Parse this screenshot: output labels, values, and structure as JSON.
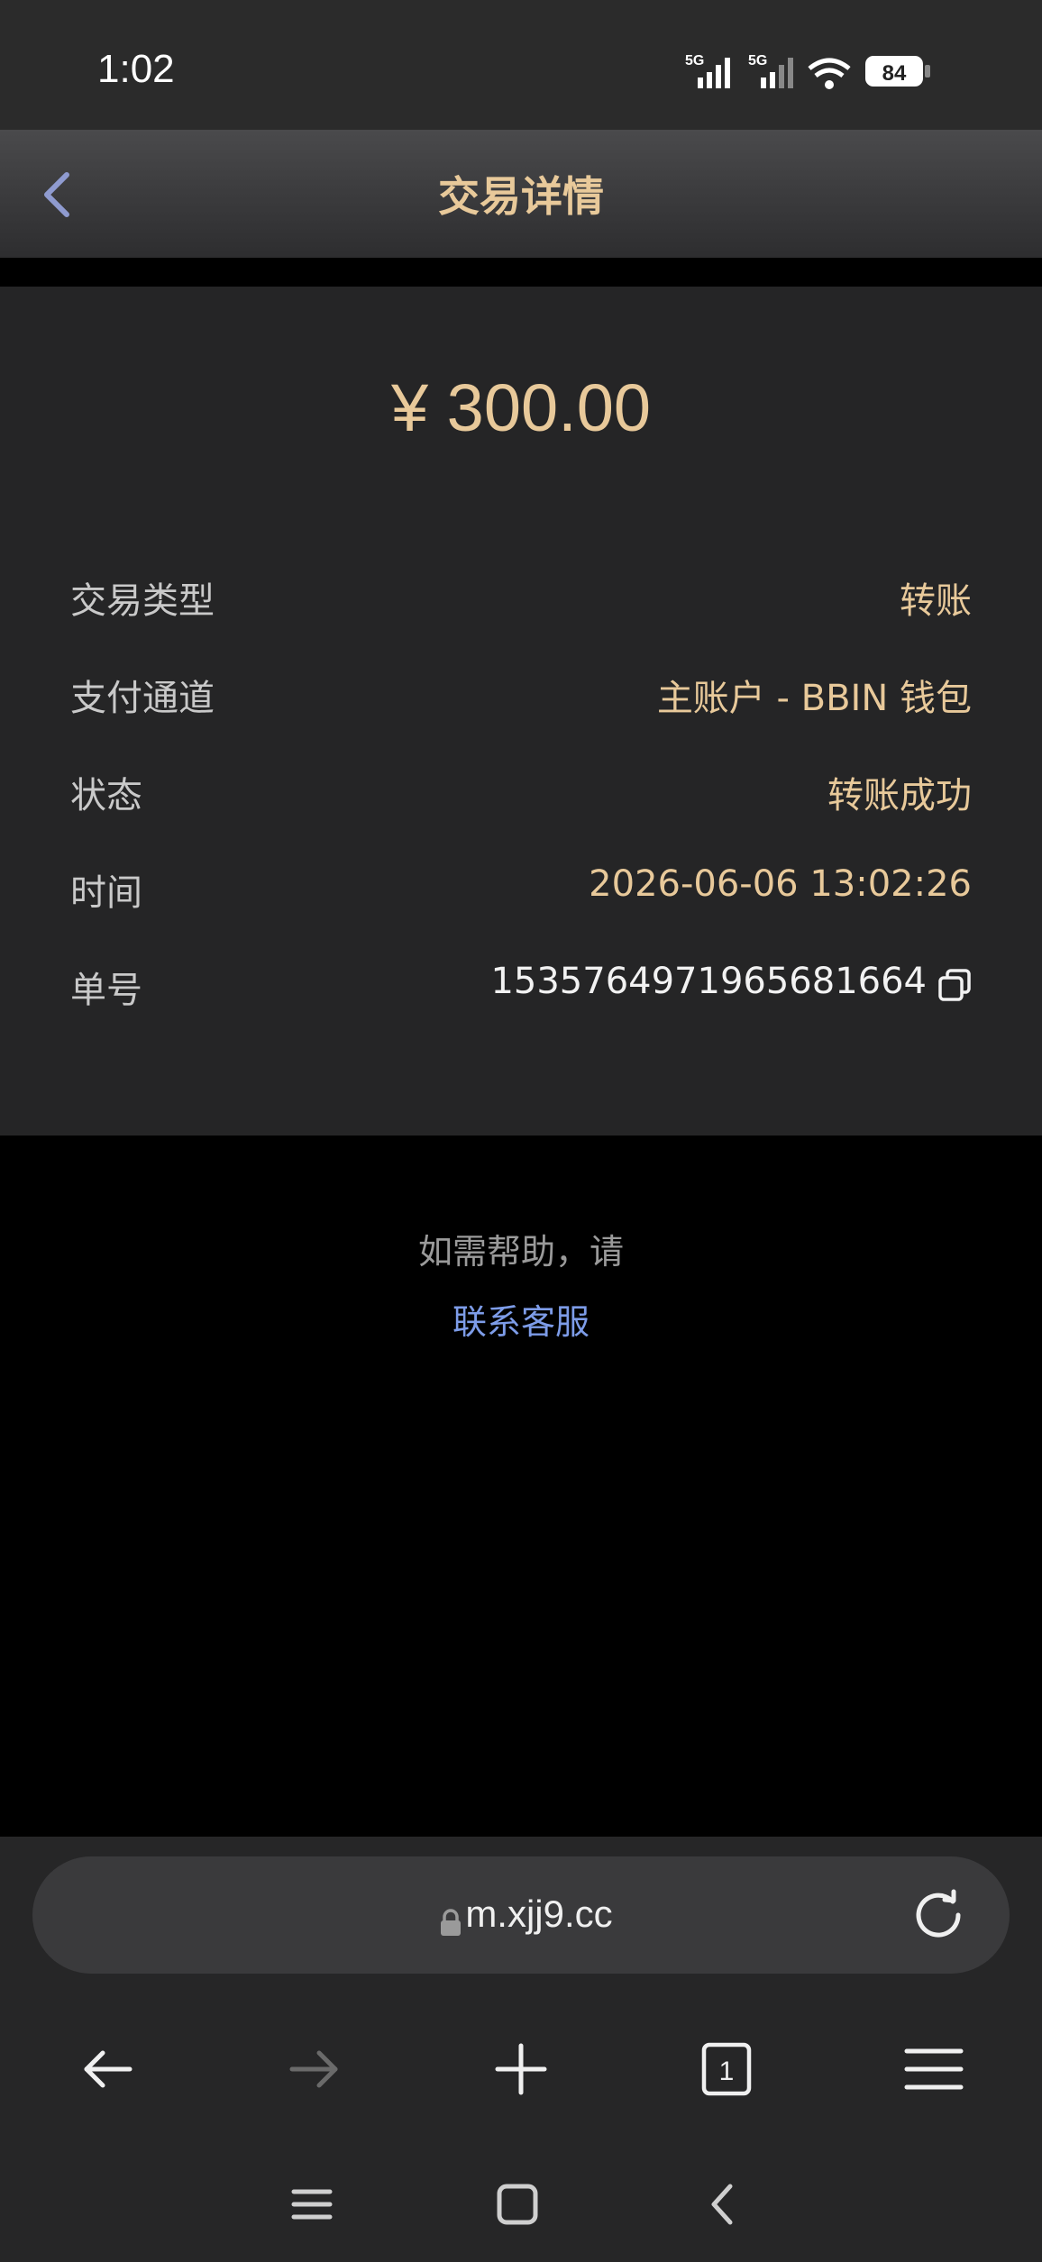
{
  "status_bar": {
    "time": "1:02",
    "signal_1_label": "5G",
    "signal_2_label": "5G",
    "battery": "84"
  },
  "header": {
    "title": "交易详情"
  },
  "transaction": {
    "amount": "¥ 300.00",
    "rows": [
      {
        "label": "交易类型",
        "value": "转账"
      },
      {
        "label": "支付通道",
        "value": "主账户 - BBIN 钱包"
      },
      {
        "label": "状态",
        "value": "转账成功"
      },
      {
        "label": "时间",
        "value": "2026-06-06 13:02:26"
      },
      {
        "label": "单号",
        "value": "1535764971965681664"
      }
    ]
  },
  "help": {
    "text": "如需帮助，请",
    "link": "联系客服"
  },
  "browser": {
    "url": "m.xjj9.cc",
    "tab_count": "1"
  },
  "colors": {
    "accent_gold": "#e8c99a",
    "link_blue": "#7d9ce8",
    "card_bg": "#252526"
  }
}
